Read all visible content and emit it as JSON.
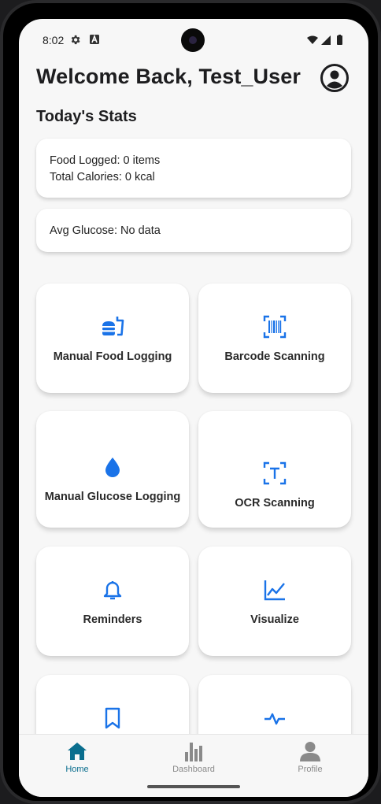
{
  "status_bar": {
    "time": "8:02"
  },
  "header": {
    "title": "Welcome Back, Test_User"
  },
  "stats": {
    "section_title": "Today's Stats",
    "food_logged": "Food Logged: 0 items",
    "total_calories": "Total Calories: 0 kcal",
    "avg_glucose": "Avg Glucose: No data"
  },
  "tiles": [
    {
      "label": "Manual Food Logging",
      "icon": "fastfood-icon"
    },
    {
      "label": "Barcode Scanning",
      "icon": "barcode-icon"
    },
    {
      "label": "Manual Glucose Logging",
      "icon": "water-drop-icon"
    },
    {
      "label": "OCR Scanning",
      "icon": "text-scan-icon"
    },
    {
      "label": "Reminders",
      "icon": "bell-icon"
    },
    {
      "label": "Visualize",
      "icon": "line-chart-icon"
    },
    {
      "label": "",
      "icon": "bookmark-icon"
    },
    {
      "label": "",
      "icon": "heart-rate-icon"
    }
  ],
  "bottom_nav": {
    "items": [
      {
        "label": "Home",
        "active": true
      },
      {
        "label": "Dashboard",
        "active": false
      },
      {
        "label": "Profile",
        "active": false
      }
    ]
  },
  "colors": {
    "accent": "#1a73e8",
    "nav_active": "#0a6e8e",
    "nav_inactive": "#8a8a8a",
    "background": "#f7f7f7",
    "card": "#ffffff"
  }
}
